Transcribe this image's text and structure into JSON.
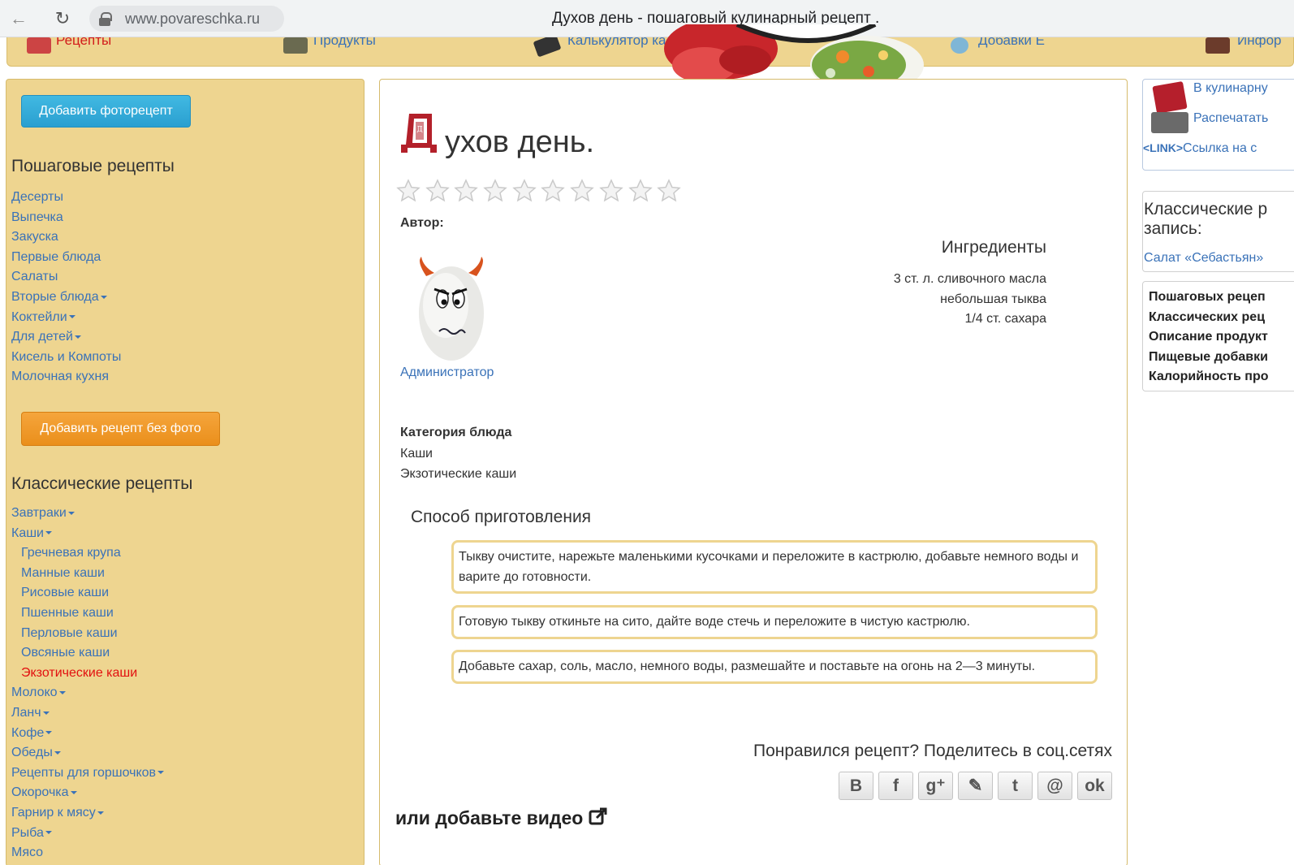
{
  "browser": {
    "url": "www.povareschka.ru",
    "tab_title": "Духов день - пошаговый кулинарный рецепт ."
  },
  "topmenu": {
    "items": [
      {
        "label": "Рецепты"
      },
      {
        "label": "Продукты"
      },
      {
        "label": "Калькулятор калорий"
      },
      {
        "label": "Добавки Е"
      },
      {
        "label": "Инфор"
      }
    ]
  },
  "sidebar": {
    "add_photo_recipe": "Добавить фоторецепт",
    "step_heading": "Пошаговые рецепты",
    "step_items": [
      {
        "label": "Десерты",
        "caret": false
      },
      {
        "label": "Выпечка",
        "caret": false
      },
      {
        "label": "Закуска",
        "caret": false
      },
      {
        "label": "Первые блюда",
        "caret": false
      },
      {
        "label": "Салаты",
        "caret": false
      },
      {
        "label": "Вторые блюда",
        "caret": true
      },
      {
        "label": "Коктейли",
        "caret": true
      },
      {
        "label": "Для детей",
        "caret": true
      },
      {
        "label": "Кисель и Компоты",
        "caret": false
      },
      {
        "label": "Молочная кухня",
        "caret": false
      }
    ],
    "add_recipe_no_photo": "Добавить рецепт без фото",
    "classic_heading": "Классические рецепты",
    "classic_items": [
      {
        "label": "Завтраки",
        "caret": true
      },
      {
        "label": "Каши",
        "caret": true
      },
      {
        "label": "Гречневая крупа",
        "sub": true
      },
      {
        "label": "Манные каши",
        "sub": true
      },
      {
        "label": "Рисовые каши",
        "sub": true
      },
      {
        "label": "Пшенные каши",
        "sub": true
      },
      {
        "label": "Перловые каши",
        "sub": true
      },
      {
        "label": "Овсяные каши",
        "sub": true
      },
      {
        "label": "Экзотические каши",
        "sub": true,
        "active": true
      },
      {
        "label": "Молоко",
        "caret": true
      },
      {
        "label": "Ланч",
        "caret": true
      },
      {
        "label": "Кофе",
        "caret": true
      },
      {
        "label": "Обеды",
        "caret": true
      },
      {
        "label": "Рецепты для горшочков",
        "caret": true
      },
      {
        "label": "Окорочка",
        "caret": true
      },
      {
        "label": "Гарнир к мясу",
        "caret": true
      },
      {
        "label": "Рыба",
        "caret": true
      },
      {
        "label": "Мясо",
        "caret": false
      }
    ]
  },
  "recipe": {
    "dropcap_letter": "Д",
    "title_rest": "ухов день.",
    "rating": {
      "max": 10,
      "value": 0
    },
    "author_label": "Автор:",
    "author_name": "Администратор",
    "ingredients_title": "Ингредиенты",
    "ingredients": [
      "3 ст. л. сливочного масла",
      "небольшая тыква",
      "1/4 ст. сахара"
    ],
    "category_label": "Категория блюда",
    "categories": [
      "Каши",
      "Экзотические каши"
    ],
    "method_title": "Способ приготовления",
    "steps": [
      "Тыкву очистите, нарежьте маленькими кусочками и переложите в кастрюлю, добавьте немного воды и варите до готовности.",
      "Готовую тыкву откиньте на сито, дайте воде стечь и переложите в чистую кастрюлю.",
      "Добавьте сахар, соль, масло, немного воды, размешайте и поставьте на огонь на 2—3 минуты."
    ],
    "share_title": "Понравился рецепт? Поделитесь в соц.сетях",
    "share_buttons": [
      {
        "icon": "vk-icon",
        "glyph": "В"
      },
      {
        "icon": "facebook-icon",
        "glyph": "f"
      },
      {
        "icon": "google-plus-icon",
        "glyph": "g⁺"
      },
      {
        "icon": "livejournal-icon",
        "glyph": "✎"
      },
      {
        "icon": "tumblr-icon",
        "glyph": "t"
      },
      {
        "icon": "mail-icon",
        "glyph": "@"
      },
      {
        "icon": "odnoklassniki-icon",
        "glyph": "ok"
      }
    ],
    "video_title": "или добавьте видео"
  },
  "right": {
    "cookbook_link": "В кулинарну",
    "print_link": "Распечатать",
    "link_tag": "<LINK>",
    "link_text": "Ссылка на с",
    "classic_title": "Классические р запись:",
    "classic_link": "Салат «Себастьян»",
    "stats": [
      "Пошаговых рецеп",
      "Классических рец",
      "Описание продукт",
      "Пищевые добавки",
      "Калорийность про"
    ]
  },
  "colors": {
    "sidebar_bg": "#eed590",
    "link": "#3a72b8",
    "active_link": "#e21010",
    "btn_blue": "#2a9fd0",
    "btn_orange": "#ea8f1b",
    "dropcap": "#b3202a"
  }
}
